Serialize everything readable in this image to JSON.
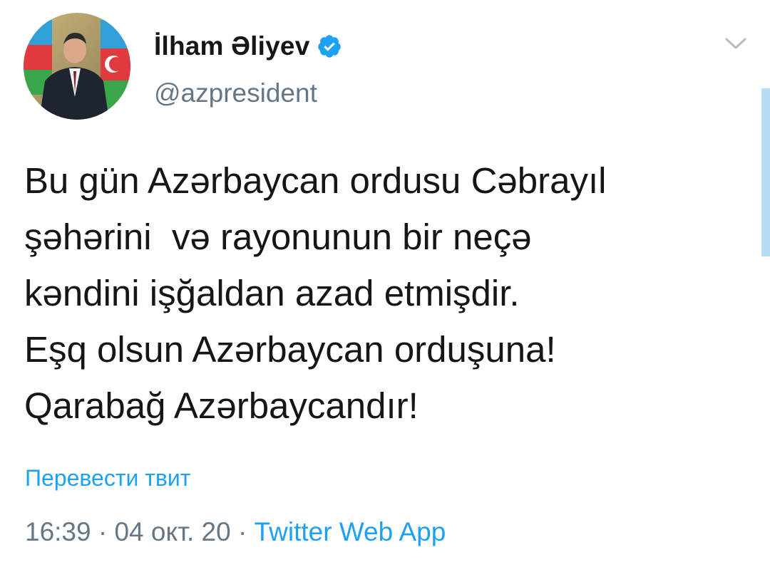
{
  "author": {
    "display_name": "İlham Əliyev",
    "handle": "@azpresident",
    "verified": true
  },
  "icons": {
    "avatar": "avatar-photo",
    "verified": "verified-badge-icon",
    "menu": "chevron-down-icon"
  },
  "tweet": {
    "lines": [
      "Bu gün Azərbaycan ordusu Cəbrayıl",
      "şəhərini  və rayonunun bir neçə",
      "kəndini işğaldan azad etmişdir.",
      "Eşq olsun Azərbaycan orduşuna!",
      "Qarabağ Azərbaycandır!"
    ]
  },
  "translate_label": "Перевести твит",
  "meta": {
    "time": "16:39",
    "separator": " · ",
    "date": "04 окт. 20",
    "source": "Twitter Web App"
  },
  "colors": {
    "accent": "#1da1f2",
    "text": "#14171a",
    "muted": "#657786",
    "scrollbar": "#b7dcf5"
  }
}
